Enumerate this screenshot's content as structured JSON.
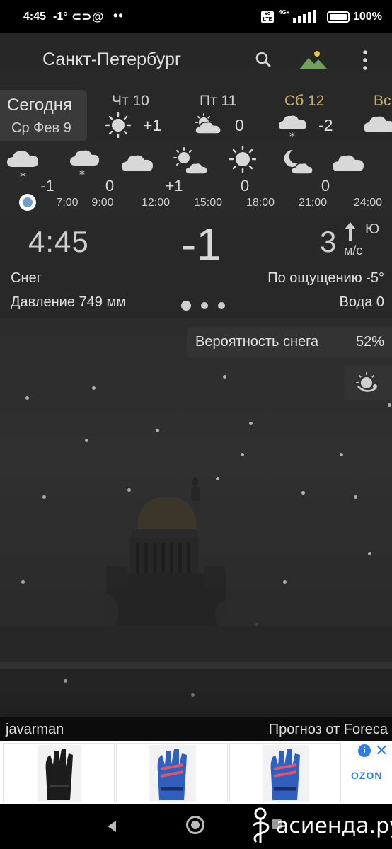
{
  "status_bar": {
    "time": "4:45",
    "temp": "-1°",
    "network": "4G+",
    "battery": "100%",
    "icons": [
      "link-icon",
      "at-icon",
      "more-dots-icon",
      "volte-icon",
      "signal-icon",
      "battery-icon"
    ]
  },
  "app_bar": {
    "title": "Санкт-Петербург",
    "icons": [
      "search-icon",
      "landscape-icon",
      "more-vert-icon"
    ]
  },
  "daily": {
    "today": {
      "label": "Сегодня",
      "date": "Ср Фев 9"
    },
    "days": [
      {
        "label": "Чт 10",
        "temp": "+1",
        "icon": "sun-icon",
        "color": "#d0d0d0"
      },
      {
        "label": "Пт 11",
        "temp": "0",
        "icon": "partly-cloudy-icon",
        "color": "#d0d0d0"
      },
      {
        "label": "Сб 12",
        "temp": "-2",
        "icon": "cloud-snow-icon",
        "color": "#c9b26a"
      },
      {
        "label": "Вс",
        "temp": "",
        "icon": "cloud-icon",
        "color": "#c9b26a"
      }
    ]
  },
  "hourly": {
    "temps": [
      "-1",
      "0",
      "+1",
      "0",
      "0"
    ],
    "times": [
      "7:00",
      "9:00",
      "12:00",
      "15:00",
      "18:00",
      "21:00",
      "24:00"
    ],
    "icons": [
      "cloud-snow-icon",
      "cloud-snow-icon",
      "cloud-icon",
      "partly-sunny-icon",
      "sun-icon",
      "moon-cloud-icon",
      "cloud-icon"
    ]
  },
  "current": {
    "time": "4:45",
    "temp": "-1",
    "wind_speed": "3",
    "wind_dir": "Ю",
    "wind_unit": "м/с",
    "condition": "Снег",
    "feels_like": "По ощущению -5°",
    "pressure": "Давление 749 мм",
    "water": "Вода 0",
    "page_count": 3,
    "page_active": 0
  },
  "snow_probability": {
    "label": "Вероятность снега",
    "value": "52%"
  },
  "footer": {
    "credit_left": "javarman",
    "credit_right": "Прогноз от Foreca"
  },
  "ad": {
    "brand": "OZON",
    "info_label": "i",
    "close_label": "✕",
    "cards": [
      "product-gloves-black",
      "product-gloves-blue",
      "product-gloves-blue"
    ]
  },
  "nav_bar": {
    "buttons": [
      "back-button",
      "home-button",
      "recent-apps-button"
    ]
  },
  "watermark": {
    "text": "асиенда.ру"
  },
  "colors": {
    "weekend": "#c9b26a",
    "accent_dot": "#6ea0c8",
    "ad_blue": "#2b7de9"
  }
}
